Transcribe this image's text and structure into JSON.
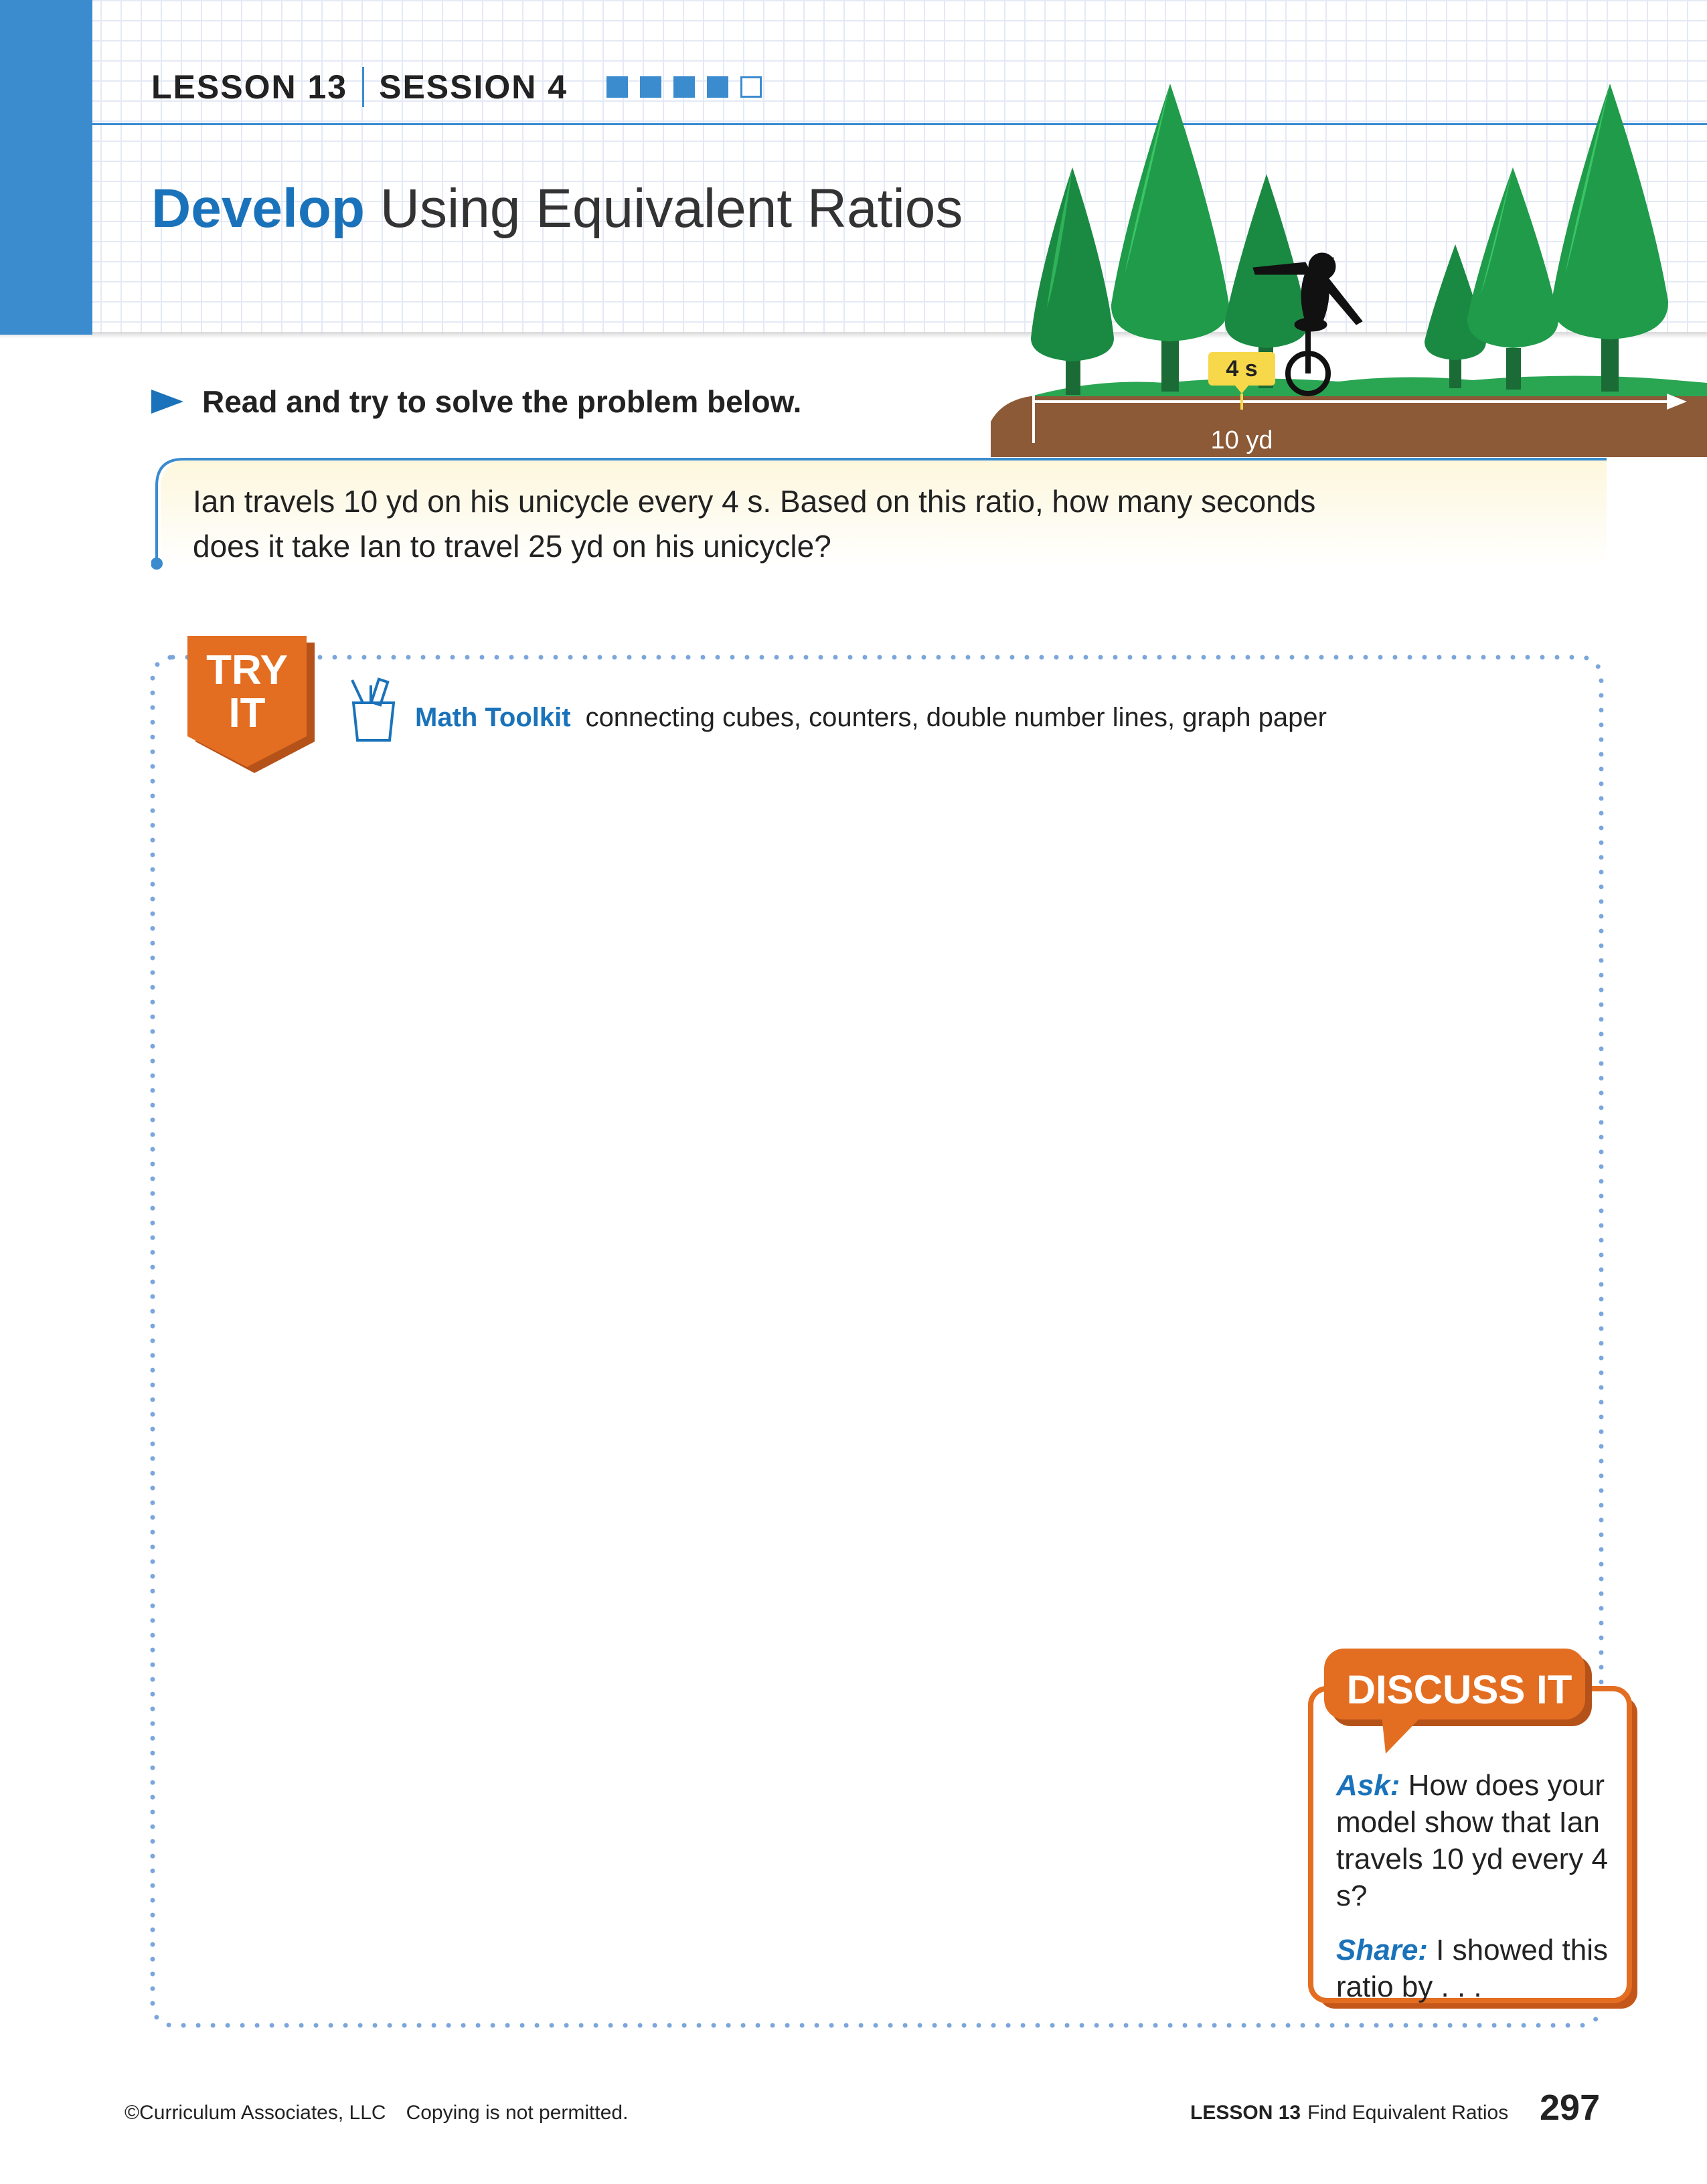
{
  "header": {
    "lesson": "LESSON 13",
    "session": "SESSION 4",
    "progress": {
      "completed": 4,
      "total": 5
    }
  },
  "title": {
    "accent": "Develop",
    "rest": " Using Equivalent Ratios"
  },
  "illustration": {
    "time_label": "4 s",
    "distance_label": "10 yd"
  },
  "instruction": "Read and try to solve the problem below.",
  "problem": {
    "line1": "Ian travels 10 yd on his unicycle every 4 s. Based on this ratio, how many seconds",
    "line2": "does it take Ian to travel 25 yd on his unicycle?"
  },
  "try_it": {
    "badge_line1": "TRY",
    "badge_line2": "IT",
    "toolkit_label": "Math Toolkit",
    "toolkit_items": "connecting cubes, counters, double number lines, graph paper"
  },
  "discuss_it": {
    "title": "DISCUSS IT",
    "ask_label": "Ask:",
    "ask_text": " How does your model show that Ian travels 10 yd every 4 s?",
    "share_label": "Share:",
    "share_text": " I showed this ratio by . . ."
  },
  "footer": {
    "copyright": "©Curriculum Associates, LLC",
    "notice": "Copying is not permitted.",
    "lesson_label": "LESSON 13",
    "lesson_title": "Find Equivalent Ratios",
    "page_number": "297"
  },
  "colors": {
    "accent_blue": "#1a73ba",
    "tab_blue": "#3b8bcf",
    "orange": "#e36e21",
    "tree_green": "#1f9b4a",
    "ground_brown": "#8c5a37",
    "label_yellow": "#f7d84a"
  }
}
